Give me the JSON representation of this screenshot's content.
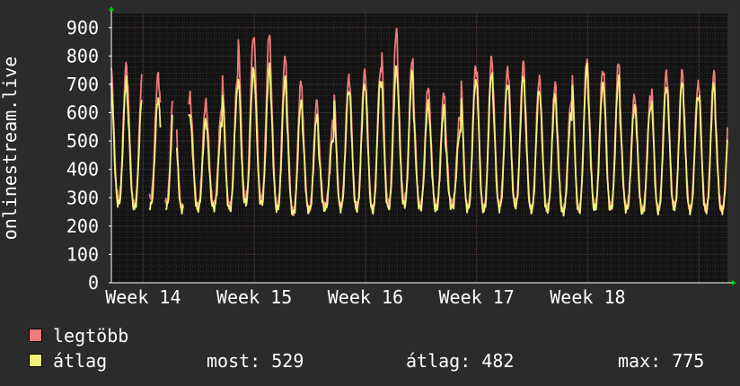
{
  "chart_data": {
    "type": "line",
    "ylabel": "onlinestream.live",
    "yticks": [
      0,
      100,
      200,
      300,
      400,
      500,
      600,
      700,
      800,
      900
    ],
    "ylim": [
      0,
      950
    ],
    "xticks": [
      "Week 14",
      "Week 15",
      "Week 16",
      "Week 17",
      "Week 18"
    ],
    "grid": true,
    "colors": {
      "background": "#2b2b2b",
      "plot": "#141414",
      "grid": "#4a4a4a",
      "axis": "#ffffff",
      "arrow": "#00cc00",
      "max_series": "#f07a7a",
      "avg_series": "#f2f27a"
    },
    "series": [
      {
        "name": "legtöbb",
        "color": "#f07a7a",
        "period_days": 1,
        "start_day": 0,
        "gaps_days": [
          [
            1.95,
            2.4
          ],
          [
            3.1,
            3.4
          ],
          [
            3.85,
            4.1
          ],
          [
            4.55,
            4.85
          ]
        ],
        "daily_peaks": [
          775,
          730,
          735,
          720,
          660,
          640,
          620,
          730,
          870,
          880,
          800,
          710,
          640,
          560,
          720,
          745,
          750,
          890,
          790,
          690,
          670,
          585,
          760,
          790,
          750,
          775,
          720,
          700,
          640,
          790,
          750,
          780,
          660,
          650,
          740,
          745,
          700,
          740,
          640
        ],
        "daily_troughs": [
          300,
          275,
          300,
          280,
          270,
          270,
          280,
          270,
          300,
          295,
          270,
          250,
          260,
          270,
          275,
          270,
          265,
          280,
          295,
          275,
          270,
          280,
          270,
          265,
          280,
          280,
          265,
          265,
          260,
          265,
          270,
          270,
          270,
          260,
          265,
          270,
          265,
          265,
          260
        ]
      },
      {
        "name": "átlag",
        "color": "#f2f27a",
        "period_days": 1,
        "start_day": 0,
        "gaps_days": [
          [
            1.95,
            2.4
          ],
          [
            3.1,
            3.4
          ],
          [
            3.85,
            4.1
          ],
          [
            4.55,
            4.85
          ]
        ],
        "daily_peaks": [
          720,
          660,
          650,
          640,
          600,
          575,
          560,
          680,
          750,
          760,
          720,
          640,
          590,
          510,
          680,
          700,
          710,
          760,
          740,
          630,
          620,
          530,
          710,
          740,
          700,
          730,
          680,
          660,
          590,
          760,
          700,
          720,
          620,
          620,
          690,
          710,
          660,
          700,
          600
        ],
        "daily_troughs": [
          280,
          265,
          270,
          265,
          260,
          260,
          265,
          260,
          280,
          280,
          260,
          245,
          255,
          260,
          265,
          260,
          255,
          265,
          275,
          265,
          260,
          265,
          260,
          255,
          265,
          270,
          255,
          255,
          250,
          255,
          260,
          260,
          260,
          250,
          255,
          262,
          255,
          255,
          255
        ]
      }
    ]
  },
  "legend": {
    "max_label": "legtöbb",
    "avg_label": "átlag"
  },
  "stats": {
    "current": "most: 529",
    "average": "átlag: 482",
    "maximum": "max: 775"
  }
}
